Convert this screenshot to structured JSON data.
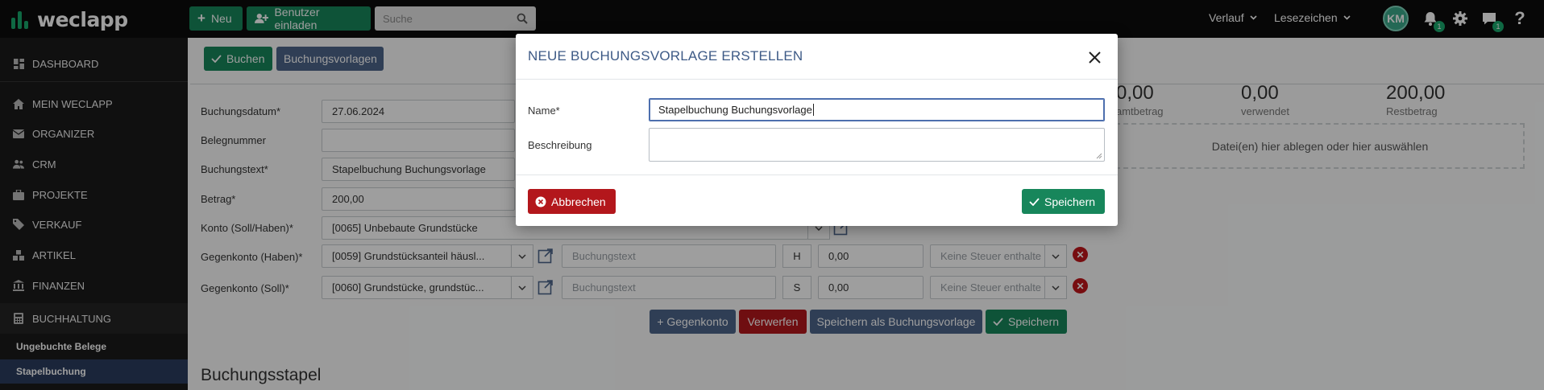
{
  "topbar": {
    "logo": "weclapp",
    "new_label": "Neu",
    "invite_label": "Benutzer einladen",
    "search_placeholder": "Suche",
    "history_label": "Verlauf",
    "bookmarks_label": "Lesezeichen",
    "avatar_initials": "KM",
    "notifications_count": "1",
    "messages_count": "1"
  },
  "sidebar": {
    "items": [
      {
        "label": "DASHBOARD",
        "icon": "dashboard-icon"
      },
      {
        "label": "MEIN WECLAPP",
        "icon": "home-icon"
      },
      {
        "label": "ORGANIZER",
        "icon": "envelope-icon"
      },
      {
        "label": "CRM",
        "icon": "users-icon"
      },
      {
        "label": "PROJEKTE",
        "icon": "briefcase-icon"
      },
      {
        "label": "VERKAUF",
        "icon": "tag-icon"
      },
      {
        "label": "ARTIKEL",
        "icon": "cubes-icon"
      },
      {
        "label": "FINANZEN",
        "icon": "bank-icon"
      },
      {
        "label": "BUCHHALTUNG",
        "icon": "calculator-icon"
      }
    ],
    "subitems": [
      {
        "label": "Ungebuchte Belege"
      },
      {
        "label": "Stapelbuchung",
        "active": true
      }
    ]
  },
  "toolbar": {
    "book_label": "Buchen",
    "templates_label": "Buchungsvorlagen"
  },
  "form": {
    "date_label": "Buchungsdatum*",
    "date_value": "27.06.2024",
    "docnum_label": "Belegnummer",
    "docnum_value": "",
    "text_label": "Buchungstext*",
    "text_value": "Stapelbuchung Buchungsvorlage",
    "amount_label": "Betrag*",
    "amount_value": "200,00",
    "account_label": "Konto (Soll/Haben)*",
    "account_value": "[0065] Unbebaute Grundstücke",
    "contra_haben_label": "Gegenkonto (Haben)*",
    "contra_haben_value": "[0059] Grundstücksanteil häusl...",
    "contra_haben_text_placeholder": "Buchungstext",
    "contra_haben_side": "H",
    "contra_haben_amount": "0,00",
    "contra_haben_tax": "Keine Steuer enthalte",
    "contra_soll_label": "Gegenkonto (Soll)*",
    "contra_soll_value": "[0060] Grundstücke, grundstüc...",
    "contra_soll_text_placeholder": "Buchungstext",
    "contra_soll_side": "S",
    "contra_soll_amount": "0,00",
    "contra_soll_tax": "Keine Steuer enthalte"
  },
  "actions": {
    "add_contra_label": "+ Gegenkonto",
    "discard_label": "Verwerfen",
    "save_template_label": "Speichern als Buchungsvorlage",
    "save_label": "Speichern"
  },
  "stats": {
    "total_value": "0,00",
    "total_label": "amtbetrag",
    "used_value": "0,00",
    "used_label": "verwendet",
    "rest_value": "200,00",
    "rest_label": "Restbetrag"
  },
  "dropzone_text": "Datei(en) hier ablegen oder hier auswählen",
  "section_title": "Buchungsstapel",
  "modal": {
    "title": "NEUE BUCHUNGSVORLAGE ERSTELLEN",
    "name_label": "Name*",
    "name_value": "Stapelbuchung Buchungsvorlage",
    "description_label": "Beschreibung",
    "description_value": "",
    "cancel_label": "Abbrechen",
    "save_label": "Speichern"
  },
  "colors": {
    "brand_green": "#17865b",
    "nav_blue": "#4d6489",
    "danger_red": "#b3171c",
    "modal_title": "#3d5a86"
  }
}
